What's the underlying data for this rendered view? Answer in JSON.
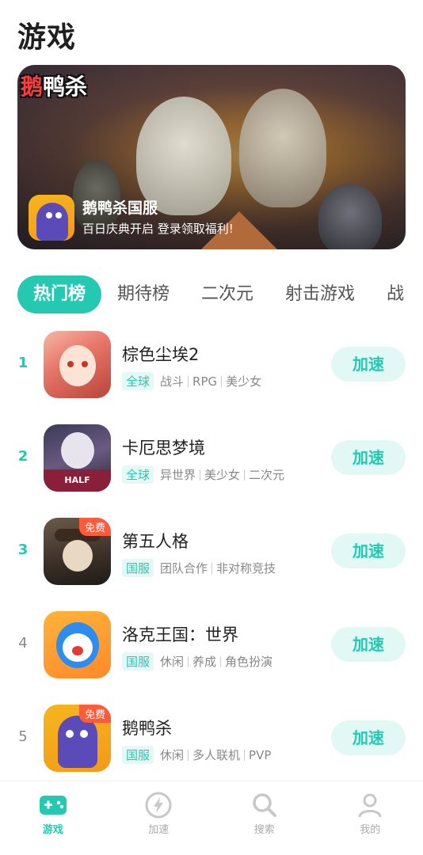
{
  "header": {
    "title": "游戏"
  },
  "banner": {
    "logo_first": "鹅",
    "logo_rest": "鸭杀",
    "title": "鹅鸭杀国服",
    "subtitle": "百日庆典开启  登录领取福利!"
  },
  "tabs": [
    {
      "label": "热门榜",
      "active": true
    },
    {
      "label": "期待榜"
    },
    {
      "label": "二次元"
    },
    {
      "label": "射击游戏"
    },
    {
      "label": "战"
    }
  ],
  "games": [
    {
      "rank": "1",
      "name": "棕色尘埃2",
      "region": "全球",
      "tags": [
        "战斗",
        "RPG",
        "美少女"
      ],
      "button": "加速"
    },
    {
      "rank": "2",
      "name": "卡厄思梦境",
      "region": "全球",
      "tags": [
        "异世界",
        "美少女",
        "二次元"
      ],
      "button": "加速"
    },
    {
      "rank": "3",
      "name": "第五人格",
      "region": "国服",
      "tags": [
        "团队合作",
        "非对称竞技"
      ],
      "button": "加速",
      "badge": "免费"
    },
    {
      "rank": "4",
      "name": "洛克王国：世界",
      "region": "国服",
      "tags": [
        "休闲",
        "养成",
        "角色扮演"
      ],
      "button": "加速"
    },
    {
      "rank": "5",
      "name": "鹅鸭杀",
      "region": "国服",
      "tags": [
        "休闲",
        "多人联机",
        "PVP"
      ],
      "button": "加速",
      "badge": "免费"
    }
  ],
  "bottom_nav": [
    {
      "label": "游戏",
      "icon": "gamepad-icon",
      "active": true
    },
    {
      "label": "加速",
      "icon": "lightning-icon"
    },
    {
      "label": "搜索",
      "icon": "search-icon"
    },
    {
      "label": "我的",
      "icon": "user-icon"
    }
  ],
  "colors": {
    "accent": "#25c9b2",
    "badge": "#ff5a3a"
  }
}
